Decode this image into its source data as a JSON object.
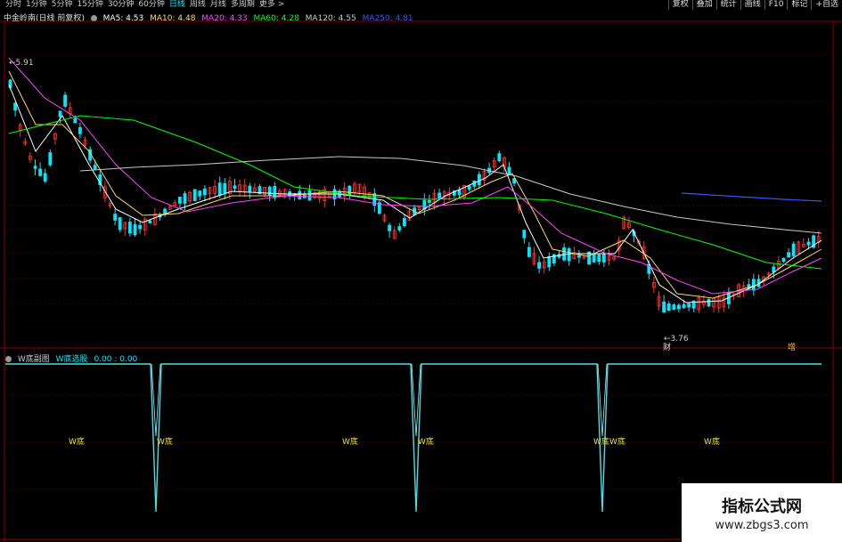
{
  "toolbar": {
    "periods": [
      "分时",
      "1分钟",
      "5分钟",
      "15分钟",
      "30分钟",
      "60分钟",
      "日线",
      "周线",
      "月线",
      "多周期",
      "更多 >"
    ],
    "active_period": "日线",
    "buttons": [
      "复权",
      "叠加",
      "统计",
      "画线",
      "F10",
      "标记",
      "+自选"
    ]
  },
  "legend": {
    "title": "中金岭南(日线 前复权)",
    "ma5": "MA5: 4.53",
    "ma10": "MA10: 4.48",
    "ma20": "MA20: 4.33",
    "ma60": "MA60: 4.28",
    "ma120": "MA120: 4.55",
    "ma250": "MA250: 4.81",
    "colors": {
      "ma5": "#ffffff",
      "ma10": "#ffd966",
      "ma20": "#ff44ff",
      "ma60": "#00ff00",
      "ma120": "#c8c8c8",
      "ma250": "#3355ff"
    }
  },
  "annotations": {
    "high": "5.91",
    "low": "3.76",
    "finance_marker": "财",
    "increase_marker": "增"
  },
  "sub": {
    "title": "W底副图",
    "indicator": "W底选股",
    "values": "0.00 : 0.00",
    "signal_label": "W底"
  },
  "watermark": {
    "title": "指标公式网",
    "url": "www.zbgs3.com"
  },
  "colors": {
    "up": "#ff3030",
    "down": "#00e8ff",
    "frame": "#8b0000",
    "signal": "#48e0e8",
    "label": "#e8e040"
  }
}
